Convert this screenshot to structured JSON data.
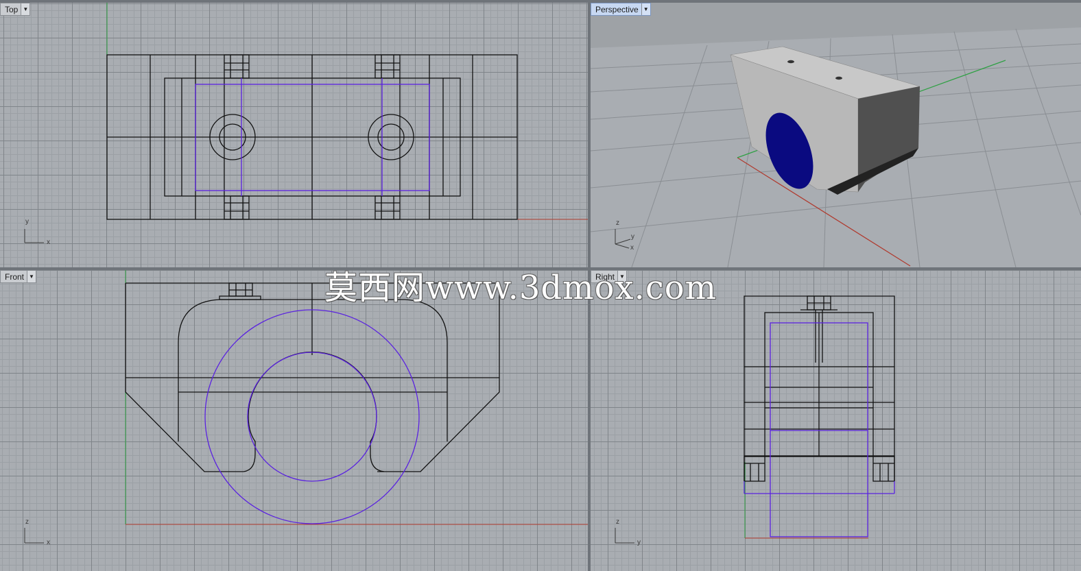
{
  "viewports": {
    "top": {
      "label": "Top",
      "axis_a": "y",
      "axis_b": "x"
    },
    "perspective": {
      "label": "Perspective",
      "axis_a": "z",
      "axis_b": "y",
      "axis_c": "x"
    },
    "front": {
      "label": "Front",
      "axis_a": "z",
      "axis_b": "x"
    },
    "right": {
      "label": "Right",
      "axis_a": "z",
      "axis_b": "y"
    }
  },
  "watermark": "莫西网www.3dmox.com",
  "colors": {
    "grid_bg": "#a9adb2",
    "wire": "#111111",
    "selected": "#5a22e0",
    "x_axis": "#b03a2e",
    "y_axis": "#2ea043",
    "solid_face_light": "#c4c4c4",
    "solid_face_dark": "#505050",
    "bore_blue": "#0a0a80",
    "active_tab": "#c7d8f2"
  }
}
